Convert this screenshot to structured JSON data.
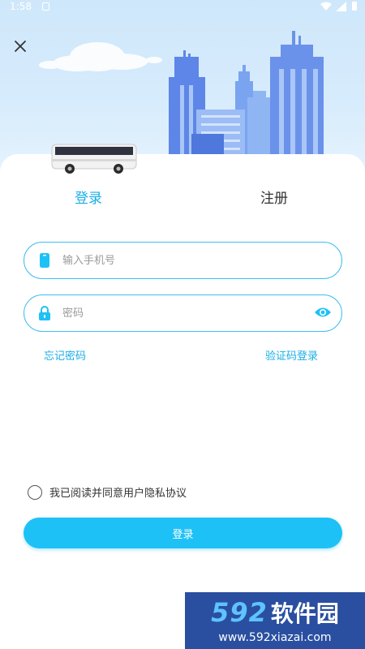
{
  "status_bar": {
    "time": "1:58"
  },
  "header": {
    "close_icon": "close-icon",
    "illustration": "city-skyline-with-bus"
  },
  "tabs": {
    "login": "登录",
    "register": "注册"
  },
  "form": {
    "phone_placeholder": "输入手机号",
    "phone_value": "",
    "password_placeholder": "密码",
    "password_value": "",
    "forgot_password": "忘记密码",
    "code_login": "验证码登录"
  },
  "agreement": {
    "text": "我已阅读并同意用户隐私协议",
    "checked": false
  },
  "login_button": "登录",
  "watermark": {
    "number": "592",
    "name": "软件园",
    "url": "www.592xiazai.com"
  },
  "colors": {
    "accent": "#19aee7",
    "button": "#1ec1f6",
    "field_border": "#3fbef0"
  }
}
